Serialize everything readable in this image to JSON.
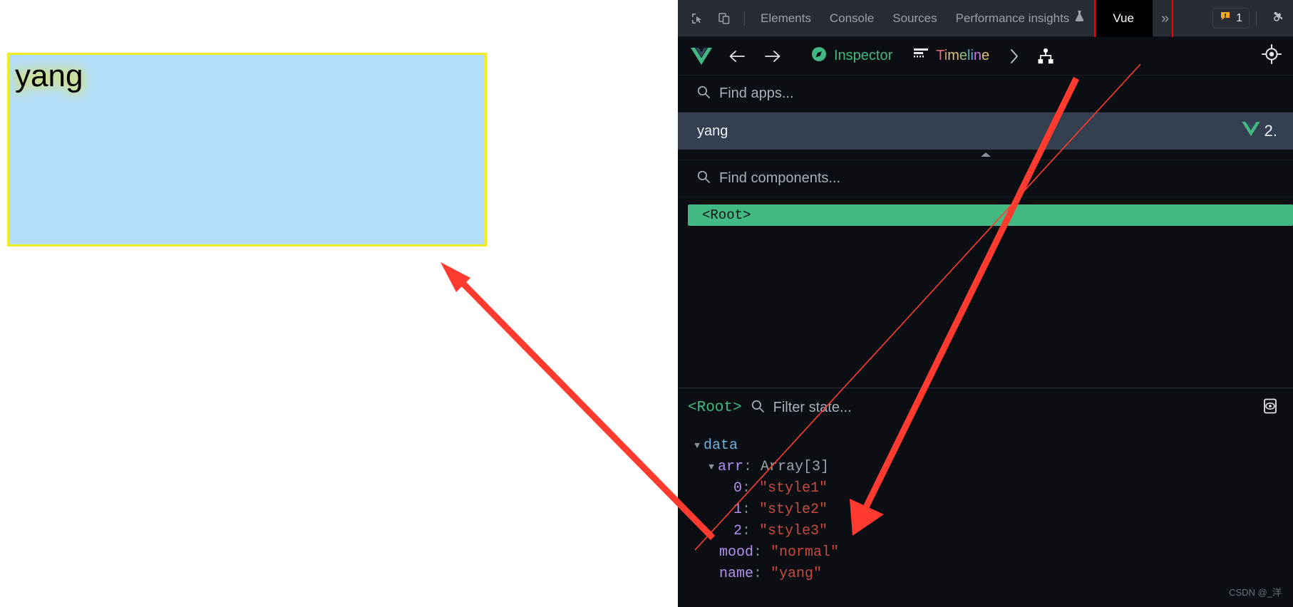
{
  "page": {
    "box_text": "yang",
    "box_bg_color": "#b3ddfb",
    "box_border_color": "#eeee22",
    "text_glow_color": "#dede3a"
  },
  "devtools": {
    "tabs": [
      {
        "label": "Elements",
        "active": false
      },
      {
        "label": "Console",
        "active": false
      },
      {
        "label": "Sources",
        "active": false
      },
      {
        "label": "Performance insights",
        "active": false,
        "badge_icon": "experiment-flask-icon"
      },
      {
        "label": "Vue",
        "active": true
      }
    ],
    "overflow_label": "»",
    "inspect_icon": "inspect-element-icon",
    "device_icon": "device-toolbar-icon",
    "warning_count": "1",
    "warning_icon": "warning-triangle-icon",
    "settings_icon": "gear-icon",
    "highlight_color": "#ff0000"
  },
  "vue": {
    "logo_icon": "vue-logo-icon",
    "back_icon": "arrow-left-icon",
    "forward_icon": "arrow-right-icon",
    "nav": [
      {
        "label": "Inspector",
        "icon": "compass-icon",
        "active": true
      },
      {
        "label": "Timeline",
        "icon": "timeline-icon",
        "active": false
      }
    ],
    "more_icon": "chevron-right-icon",
    "components_icon": "component-tree-icon",
    "target_icon": "crosshair-target-icon",
    "app_search": {
      "icon": "search-icon",
      "placeholder": "Find apps...",
      "value": ""
    },
    "selected_app": {
      "name": "yang",
      "version_prefix": "2.",
      "vue_icon": "vue-logo-icon"
    },
    "collapse_icon": "chevron-up-icon",
    "component_search": {
      "icon": "search-icon",
      "placeholder": "Find components...",
      "value": ""
    },
    "tree": {
      "nodes": [
        {
          "label": "<Root>",
          "selected": true
        }
      ]
    },
    "state_panel": {
      "component": "<Root>",
      "filter": {
        "icon": "search-icon",
        "placeholder": "Filter state...",
        "value": ""
      },
      "edit_icon": "inspect-state-icon",
      "groups": [
        {
          "name": "data",
          "expanded": true,
          "caret": "▼",
          "entries": [
            {
              "key": "arr",
              "type": "Array[3]",
              "expanded": true,
              "caret": "▼",
              "children": [
                {
                  "key": "0",
                  "value": "\"style1\""
                },
                {
                  "key": "1",
                  "value": "\"style2\""
                },
                {
                  "key": "2",
                  "value": "\"style3\""
                }
              ]
            },
            {
              "key": "mood",
              "value": "\"normal\""
            },
            {
              "key": "name",
              "value": "\"yang\""
            }
          ]
        }
      ]
    }
  },
  "watermark": "CSDN @_洋"
}
